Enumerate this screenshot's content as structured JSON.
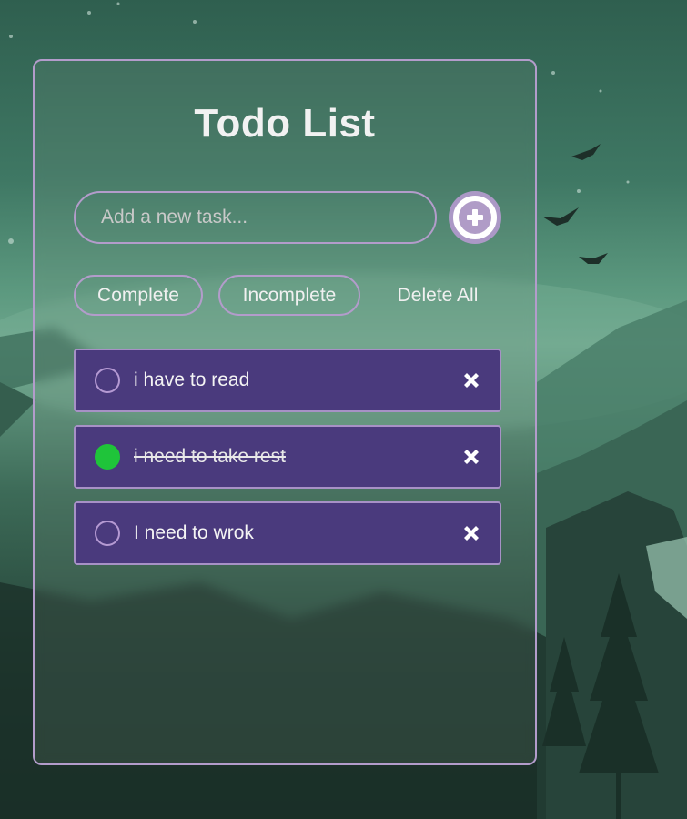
{
  "app": {
    "title": "Todo List"
  },
  "input": {
    "placeholder": "Add a new task...",
    "value": ""
  },
  "filters": {
    "complete_label": "Complete",
    "incomplete_label": "Incomplete",
    "delete_all_label": "Delete All"
  },
  "tasks": [
    {
      "text": "i have to read",
      "completed": false
    },
    {
      "text": "i need to take rest",
      "completed": true
    },
    {
      "text": "I need to wrok",
      "completed": false
    }
  ],
  "colors": {
    "accent_border": "#b39ccb",
    "task_bg": "#4a3a7d",
    "done_check": "#1fc43a"
  },
  "icons": {
    "add": "plus-circle-icon",
    "delete": "close-x-icon",
    "check": "circle-check-icon"
  }
}
